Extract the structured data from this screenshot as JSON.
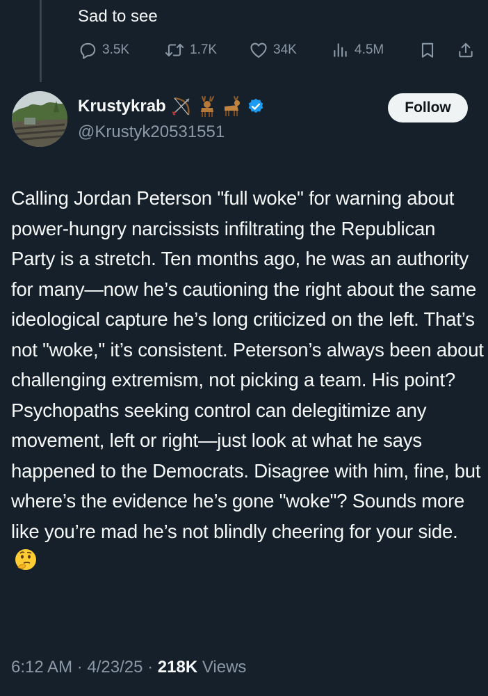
{
  "previous_tweet": {
    "text": "Sad to see",
    "replies": "3.5K",
    "reposts": "1.7K",
    "likes": "34K",
    "views": "4.5M"
  },
  "tweet": {
    "display_name": "Krustykrab",
    "name_emojis": [
      "bow-and-arrow",
      "deer",
      "deer"
    ],
    "verified": true,
    "handle": "@Krustyk20531551",
    "follow_label": "Follow",
    "body": "Calling Jordan Peterson \"full woke\" for warning about power-hungry narcissists infiltrating the Republican Party is a stretch. Ten months ago, he was an authority for many—now he’s cautioning the right about the same ideological capture he’s long criticized on the left. That’s not \"woke,\" it’s consistent. Peterson’s always been about challenging extremism, not picking a team. His point? Psychopaths seeking control can delegitimize any movement, left or right—just look at what he says happened to the Democrats. Disagree with him, fine, but where’s the evidence he’s gone \"woke\"? Sounds more like you’re mad he’s not blindly cheering for your side.",
    "end_emoji": "thinking-face",
    "time": "6:12 AM",
    "date": "4/23/25",
    "views_count": "218K",
    "views_label": "Views"
  },
  "colors": {
    "background": "#15202b",
    "text_primary": "#f7f9f9",
    "text_secondary": "#8b98a5",
    "verified": "#1d9bf0",
    "follow_bg": "#eff3f4"
  }
}
